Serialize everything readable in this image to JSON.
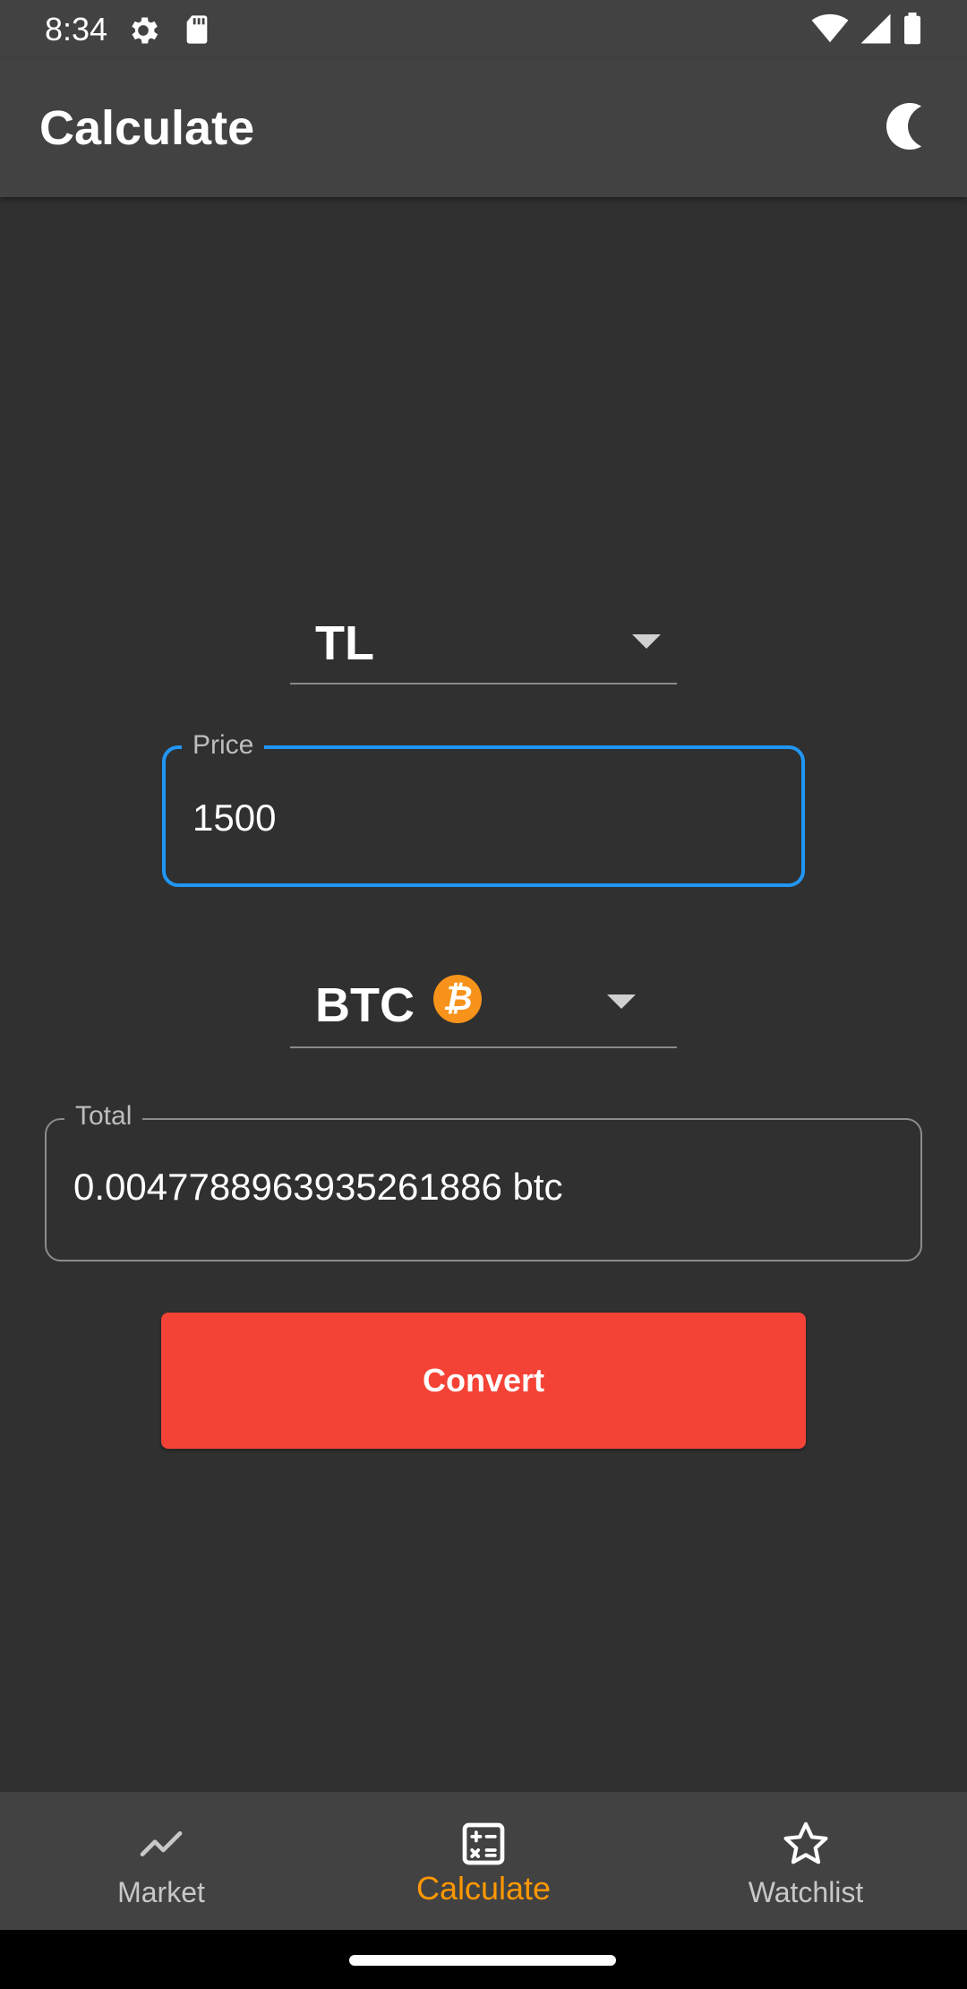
{
  "status_bar": {
    "time": "8:34",
    "icons": [
      "settings-gear-icon",
      "sd-card-icon",
      "wifi-icon",
      "cell-signal-icon",
      "battery-icon"
    ]
  },
  "app_bar": {
    "title": "Calculate",
    "theme_toggle_icon": "moon-icon"
  },
  "converter": {
    "from_currency": "TL",
    "price_label": "Price",
    "price_value": "1500",
    "to_currency": "BTC",
    "to_currency_icon": "bitcoin-icon",
    "total_label": "Total",
    "total_value": "0.0047788963935261886 btc",
    "convert_label": "Convert"
  },
  "bottom_nav": {
    "items": [
      {
        "label": "Market",
        "icon": "trending-line-icon",
        "active": false
      },
      {
        "label": "Calculate",
        "icon": "calculator-icon",
        "active": true
      },
      {
        "label": "Watchlist",
        "icon": "star-outline-icon",
        "active": false
      }
    ]
  },
  "colors": {
    "background": "#303030",
    "bar": "#424242",
    "accent": "#ff9800",
    "focus": "#2196f3",
    "button": "#f44336"
  }
}
